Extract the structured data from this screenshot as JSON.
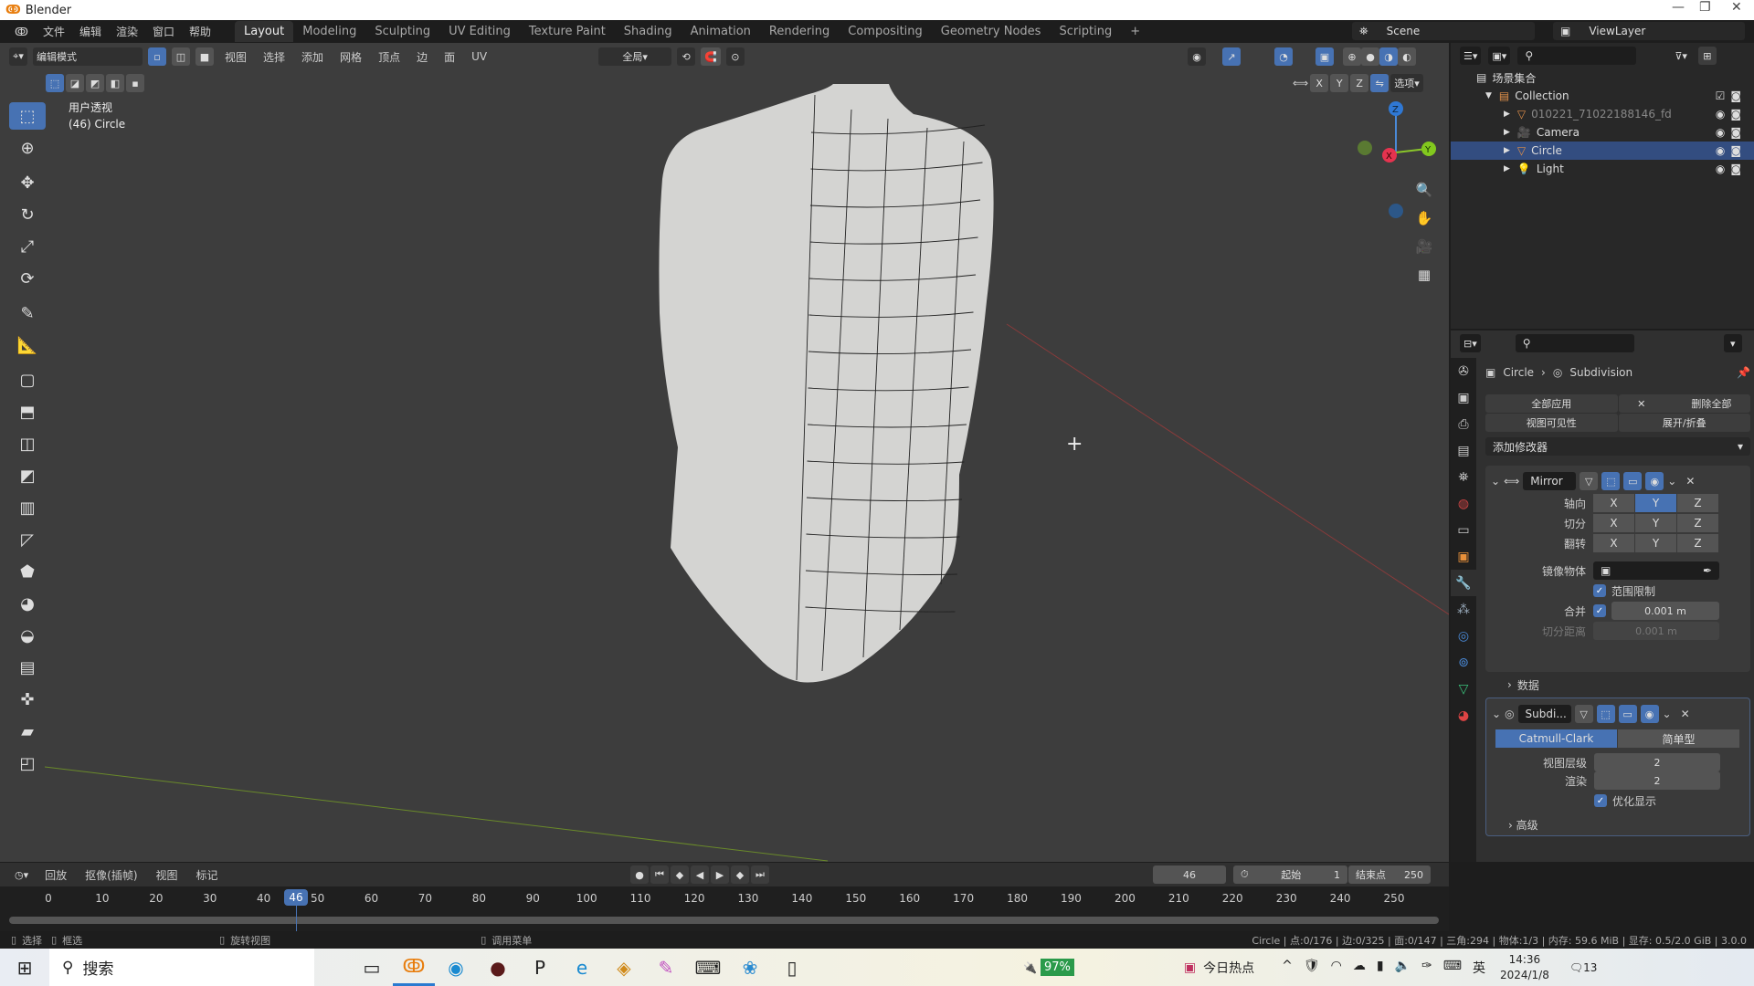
{
  "window": {
    "title": "Blender",
    "app_icon": "blender-logo",
    "controls": [
      "—",
      "❐",
      "✕"
    ]
  },
  "menubar": {
    "items": [
      "文件",
      "编辑",
      "渲染",
      "窗口",
      "帮助"
    ],
    "workspaces": [
      "Layout",
      "Modeling",
      "Sculpting",
      "UV Editing",
      "Texture Paint",
      "Shading",
      "Animation",
      "Rendering",
      "Compositing",
      "Geometry Nodes",
      "Scripting",
      "+"
    ],
    "active_workspace": "Layout",
    "scene": "Scene",
    "view_layer": "ViewLayer"
  },
  "viewport_header": {
    "mode": "编辑模式",
    "menus": [
      "视图",
      "选择",
      "添加",
      "网格",
      "顶点",
      "边",
      "面",
      "UV"
    ],
    "orientation": "全局",
    "axes": [
      "X",
      "Y",
      "Z"
    ],
    "options": "选项"
  },
  "viewport": {
    "view_name": "用户透视",
    "object_info": "(46) Circle",
    "accent": "#4772b3",
    "gizmo": {
      "z": "Z",
      "x": "X",
      "y": "Y"
    }
  },
  "toolbar": {
    "tools": [
      "select-box-icon",
      "cursor-icon",
      "move-icon",
      "rotate-icon",
      "scale-icon",
      "transform-icon",
      "annotate-icon",
      "measure-icon",
      "add-cube-icon",
      "extrude-icon",
      "inset-icon",
      "bevel-icon",
      "loop-cut-icon",
      "knife-icon",
      "poly-build-icon",
      "spin-icon",
      "smooth-icon",
      "edge-slide-icon",
      "shrink-fatten-icon",
      "shear-icon",
      "rip-icon"
    ]
  },
  "outliner": {
    "root": "场景集合",
    "rows": [
      {
        "name": "Collection",
        "level": 1,
        "icon": "collection-icon"
      },
      {
        "name": "010221_71022188146_fd",
        "level": 2,
        "icon": "mesh-icon",
        "dim": true
      },
      {
        "name": "Camera",
        "level": 2,
        "icon": "camera-icon"
      },
      {
        "name": "Circle",
        "level": 2,
        "icon": "mesh-icon",
        "selected": true
      },
      {
        "name": "Light",
        "level": 2,
        "icon": "light-icon"
      }
    ]
  },
  "properties": {
    "breadcrumb": {
      "object": "Circle",
      "modifier": "Subdivision"
    },
    "apply_all": "全部应用",
    "delete_all": "删除全部",
    "viewport_vis": "视图可见性",
    "expand_collapse": "展开/折叠",
    "add_modifier": "添加修改器",
    "mirror": {
      "name": "Mirror",
      "axis_label": "轴向",
      "bisect_label": "切分",
      "flip_label": "翻转",
      "axes": [
        "X",
        "Y",
        "Z"
      ],
      "axis_active": "Y",
      "mirror_object_label": "镜像物体",
      "clipping_label": "范围限制",
      "clipping": true,
      "merge_label": "合并",
      "merge": true,
      "merge_value": "0.001 m",
      "bisect_dist_label": "切分距离",
      "bisect_dist_value": "0.001 m",
      "data_label": "数据"
    },
    "subdiv": {
      "name": "Subdi...",
      "catmull": "Catmull-Clark",
      "simple": "简单型",
      "levels_label": "视图层级",
      "levels": "2",
      "render_label": "渲染",
      "render": "2",
      "optimal_label": "优化显示",
      "optimal": true,
      "advanced_label": "高级"
    }
  },
  "timeline": {
    "menus": [
      "回放",
      "抠像(插帧)",
      "视图",
      "标记"
    ],
    "current_frame": "46",
    "start_label": "起始",
    "start": "1",
    "end_label": "结束点",
    "end": "250",
    "ticks": [
      "0",
      "10",
      "20",
      "30",
      "40",
      "50",
      "60",
      "70",
      "80",
      "90",
      "100",
      "110",
      "120",
      "130",
      "140",
      "150",
      "160",
      "170",
      "180",
      "190",
      "200",
      "210",
      "220",
      "230",
      "240",
      "250"
    ]
  },
  "statusbar": {
    "select": "选择",
    "box_select": "框选",
    "rotate_view": "旋转视图",
    "call_menu": "调用菜单",
    "stats": "Circle | 点:0/176 | 边:0/325 | 面:0/147 | 三角:294 | 物体:1/3 | 内存: 59.6 MiB | 显存: 0.5/2.0 GiB | 3.0.0"
  },
  "taskbar": {
    "search": "搜索",
    "battery": "97%",
    "news": "今日热点",
    "ime": "英",
    "time": "14:36",
    "date": "2024/1/8",
    "notifications": "13"
  }
}
